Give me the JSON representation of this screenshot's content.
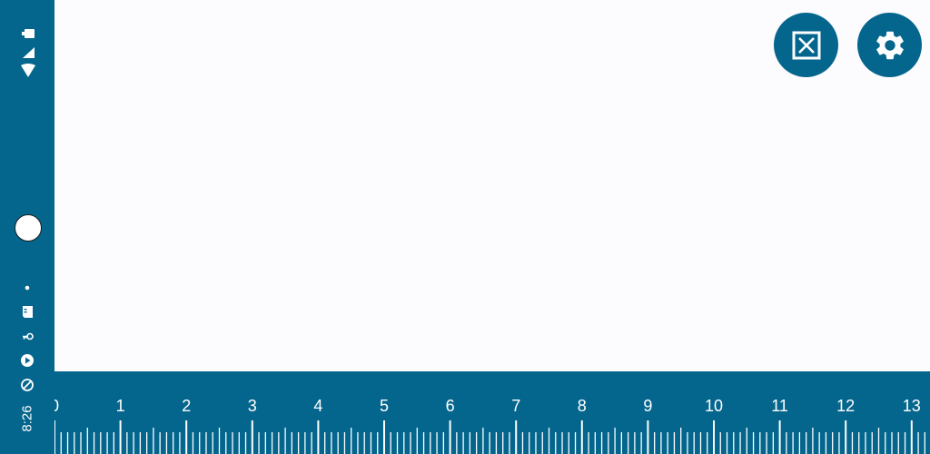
{
  "status_bar": {
    "time": "8:26",
    "icons": [
      "battery-icon",
      "signal-icon",
      "wifi-icon",
      "dot-icon",
      "sim-card-icon",
      "key-icon",
      "play-store-icon",
      "data-saver-icon"
    ]
  },
  "toolbar": {
    "buttons": [
      {
        "name": "close-box-button",
        "icon": "close-box-icon"
      },
      {
        "name": "settings-button",
        "icon": "gear-icon"
      }
    ]
  },
  "ruler": {
    "labels": [
      "0",
      "1",
      "2",
      "3",
      "4",
      "5",
      "6",
      "7",
      "8",
      "9",
      "10",
      "11",
      "12",
      "13"
    ],
    "subdivisions_per_unit": 10,
    "color": "#05668d",
    "tick_color": "#ffffff"
  },
  "colors": {
    "accent": "#05668d",
    "background": "#fcfbfe"
  }
}
